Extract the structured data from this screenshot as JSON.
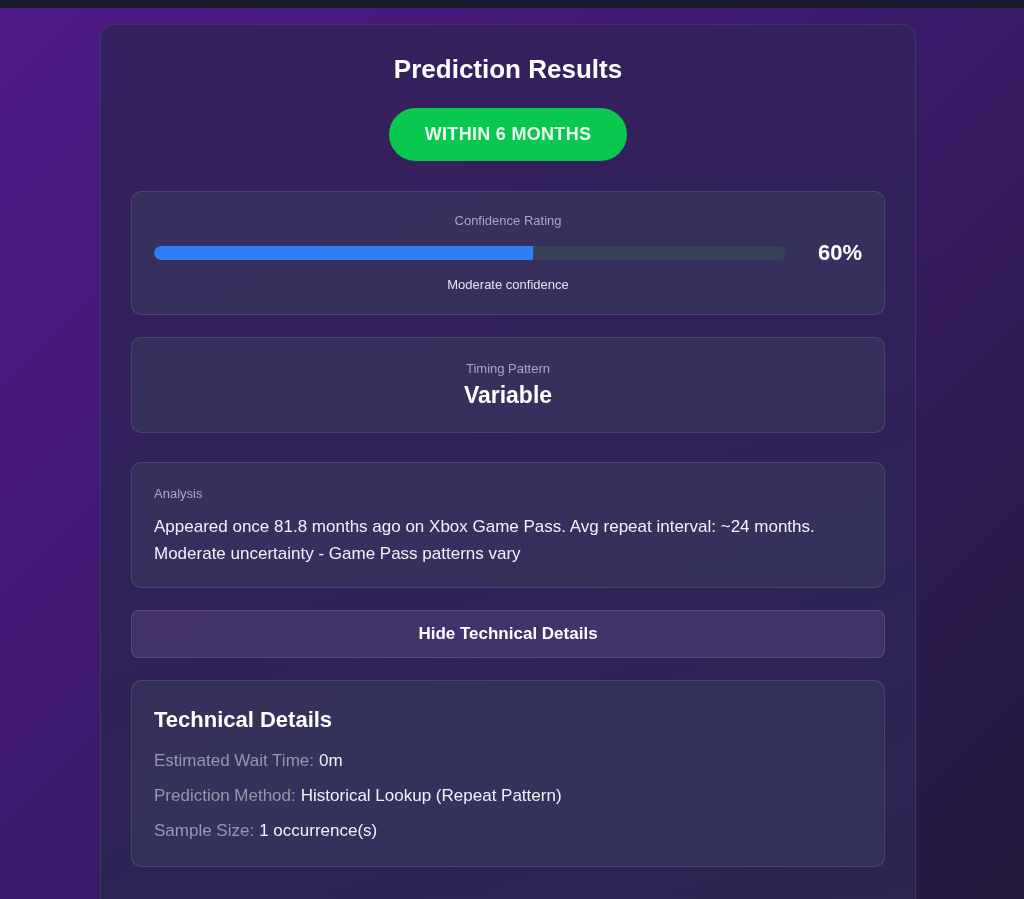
{
  "title": "Prediction Results",
  "badge": "WITHIN 6 MONTHS",
  "confidence": {
    "label": "Confidence Rating",
    "level": 0.6,
    "reading": "60%",
    "caption": "Moderate confidence"
  },
  "timing": {
    "label": "Timing Pattern",
    "value": "Variable"
  },
  "analysis": {
    "label": "Analysis",
    "text": "Appeared once 81.8 months ago on Xbox Game Pass. Avg repeat interval: ~24 months. Moderate uncertainty - Game Pass patterns vary"
  },
  "toggle_button": "Hide Technical Details",
  "technical_details": {
    "title": "Technical Details",
    "rows": [
      {
        "label": "Estimated Wait Time:",
        "value": "0m"
      },
      {
        "label": "Prediction Method:",
        "value": "Historical Lookup (Repeat Pattern)"
      },
      {
        "label": "Sample Size:",
        "value": "1 occurrence(s)"
      }
    ]
  }
}
